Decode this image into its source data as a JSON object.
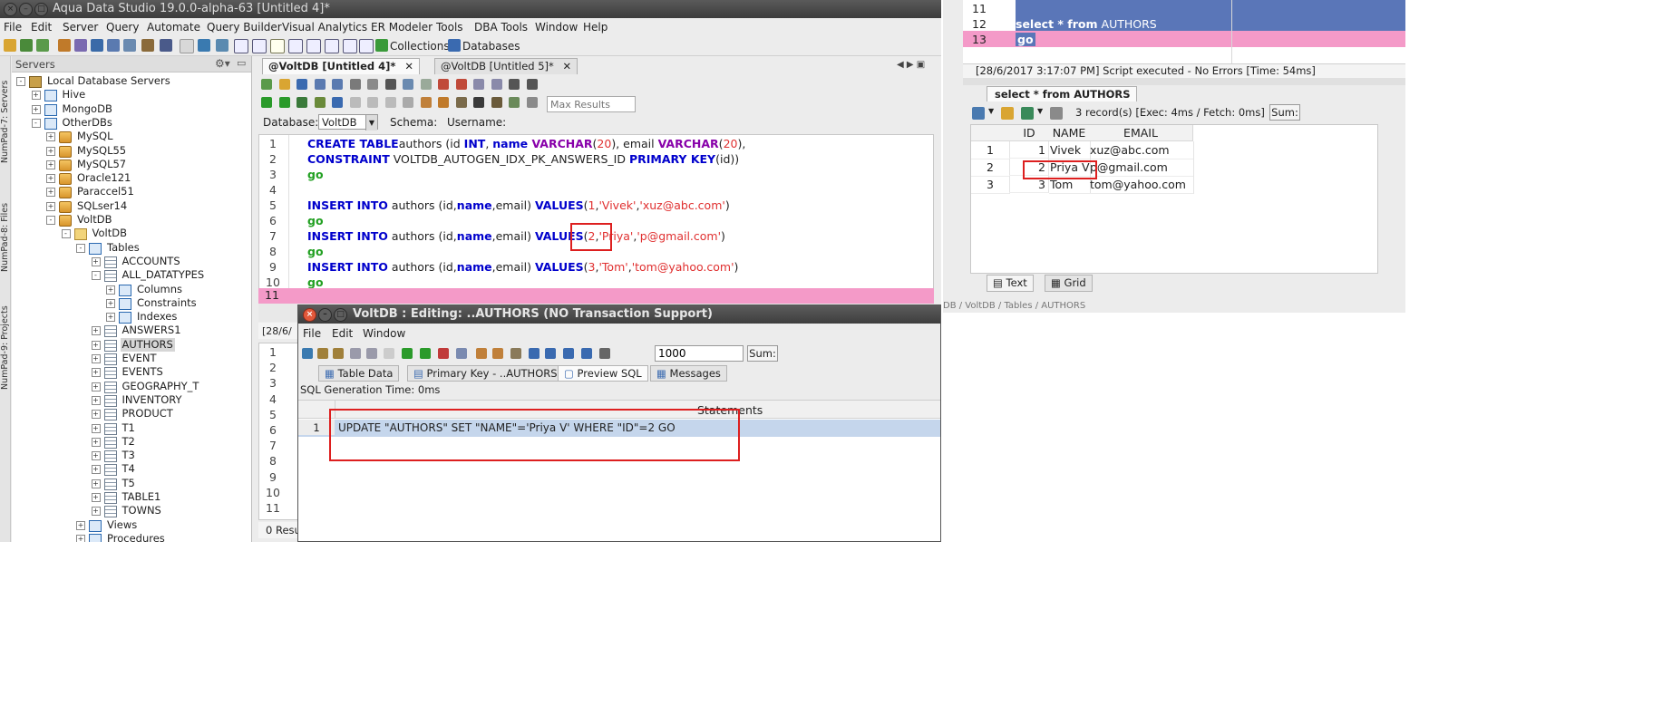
{
  "window": {
    "title": "Aqua Data Studio 19.0.0-alpha-63 [Untitled 4]*"
  },
  "menu": [
    "File",
    "Edit",
    "Server",
    "Query",
    "Automate",
    "Query Builder",
    "Visual Analytics",
    "ER Modeler",
    "Tools",
    "DBA Tools",
    "Window",
    "Help"
  ],
  "toolbar": {
    "collections": "Collections",
    "databases": "Databases"
  },
  "side_strip": [
    "NumPad-7: Servers",
    "NumPad-8: Files",
    "NumPad-9: Projects"
  ],
  "servers": {
    "header": "Servers",
    "tree": [
      {
        "label": "Local Database Servers",
        "depth": 0,
        "icon": "server-icon",
        "exp": "-"
      },
      {
        "label": "Hive",
        "depth": 1,
        "icon": "folder-icon",
        "exp": "+"
      },
      {
        "label": "MongoDB",
        "depth": 1,
        "icon": "folder-icon",
        "exp": "+"
      },
      {
        "label": "OtherDBs",
        "depth": 1,
        "icon": "folder-icon",
        "exp": "-"
      },
      {
        "label": "MySQL",
        "depth": 2,
        "icon": "database-icon",
        "exp": "+"
      },
      {
        "label": "MySQL55",
        "depth": 2,
        "icon": "database-icon",
        "exp": "+"
      },
      {
        "label": "MySQL57",
        "depth": 2,
        "icon": "database-icon",
        "exp": "+"
      },
      {
        "label": "Oracle121",
        "depth": 2,
        "icon": "database-icon",
        "exp": "+"
      },
      {
        "label": "Paraccel51",
        "depth": 2,
        "icon": "database-icon",
        "exp": "+"
      },
      {
        "label": "SQLser14",
        "depth": 2,
        "icon": "database-icon",
        "exp": "+"
      },
      {
        "label": "VoltDB",
        "depth": 2,
        "icon": "database-icon",
        "exp": "-"
      },
      {
        "label": "VoltDB",
        "depth": 3,
        "icon": "file-icon",
        "exp": "-"
      },
      {
        "label": "Tables",
        "depth": 4,
        "icon": "folder-icon",
        "exp": "-"
      },
      {
        "label": "ACCOUNTS",
        "depth": 5,
        "icon": "table-icon",
        "exp": "+"
      },
      {
        "label": "ALL_DATATYPES",
        "depth": 5,
        "icon": "table-icon",
        "exp": "-"
      },
      {
        "label": "Columns",
        "depth": 6,
        "icon": "folder-icon",
        "exp": "+"
      },
      {
        "label": "Constraints",
        "depth": 6,
        "icon": "folder-icon",
        "exp": "+"
      },
      {
        "label": "Indexes",
        "depth": 6,
        "icon": "folder-icon",
        "exp": "+"
      },
      {
        "label": "ANSWERS1",
        "depth": 5,
        "icon": "table-icon",
        "exp": "+"
      },
      {
        "label": "AUTHORS",
        "depth": 5,
        "icon": "table-icon",
        "exp": "+",
        "selected": true
      },
      {
        "label": "EVENT",
        "depth": 5,
        "icon": "table-icon",
        "exp": "+"
      },
      {
        "label": "EVENTS",
        "depth": 5,
        "icon": "table-icon",
        "exp": "+"
      },
      {
        "label": "GEOGRAPHY_T",
        "depth": 5,
        "icon": "table-icon",
        "exp": "+"
      },
      {
        "label": "INVENTORY",
        "depth": 5,
        "icon": "table-icon",
        "exp": "+"
      },
      {
        "label": "PRODUCT",
        "depth": 5,
        "icon": "table-icon",
        "exp": "+"
      },
      {
        "label": "T1",
        "depth": 5,
        "icon": "table-icon",
        "exp": "+"
      },
      {
        "label": "T2",
        "depth": 5,
        "icon": "table-icon",
        "exp": "+"
      },
      {
        "label": "T3",
        "depth": 5,
        "icon": "table-icon",
        "exp": "+"
      },
      {
        "label": "T4",
        "depth": 5,
        "icon": "table-icon",
        "exp": "+"
      },
      {
        "label": "T5",
        "depth": 5,
        "icon": "table-icon",
        "exp": "+"
      },
      {
        "label": "TABLE1",
        "depth": 5,
        "icon": "table-icon",
        "exp": "+"
      },
      {
        "label": "TOWNS",
        "depth": 5,
        "icon": "table-icon",
        "exp": "+"
      },
      {
        "label": "Views",
        "depth": 4,
        "icon": "folder-icon",
        "exp": "+"
      },
      {
        "label": "Procedures",
        "depth": 4,
        "icon": "folder-icon",
        "exp": "+"
      }
    ]
  },
  "editor": {
    "tabs": [
      "@VoltDB [Untitled 4]*",
      "@VoltDB [Untitled 5]*"
    ],
    "max_results_placeholder": "Max Results",
    "database_label": "Database:",
    "database_value": "VoltDB",
    "schema_label": "Schema:",
    "username_label": "Username:",
    "line_numbers": [
      "1",
      "2",
      "3",
      "4",
      "5",
      "6",
      "7",
      "8",
      "9",
      "10",
      "11"
    ],
    "code": {
      "l1": [
        [
          "kw",
          "CREATE TABLE"
        ],
        [
          "",
          "authors (id "
        ],
        [
          "kw",
          "INT"
        ],
        [
          "",
          ", "
        ],
        [
          "kw",
          "name"
        ],
        [
          "",
          ""
        ],
        [
          "ty",
          " VARCHAR"
        ],
        [
          "",
          "("
        ],
        [
          "num",
          "20"
        ],
        [
          "",
          "), email "
        ],
        [
          "ty",
          "VARCHAR"
        ],
        [
          "",
          "("
        ],
        [
          "num",
          "20"
        ],
        [
          "",
          "),"
        ]
      ],
      "l2": [
        [
          "kw",
          "CONSTRAINT"
        ],
        [
          "",
          " VOLTDB_AUTOGEN_IDX_PK_ANSWERS_ID "
        ],
        [
          "kw",
          "PRIMARY KEY"
        ],
        [
          "",
          "(id))"
        ]
      ],
      "l3": [
        [
          "go",
          "go"
        ]
      ],
      "l5": [
        [
          "kw",
          "INSERT INTO"
        ],
        [
          "",
          " authors (id,"
        ],
        [
          "kw",
          "name"
        ],
        [
          "",
          ",email) "
        ],
        [
          "kw",
          "VALUES"
        ],
        [
          "",
          "("
        ],
        [
          "num",
          "1"
        ],
        [
          "",
          ","
        ],
        [
          "str",
          "'Vivek'"
        ],
        [
          "",
          ","
        ],
        [
          "str",
          "'xuz@abc.com'"
        ],
        [
          "",
          ")"
        ]
      ],
      "l6": [
        [
          "go",
          "go"
        ]
      ],
      "l7": [
        [
          "kw",
          "INSERT INTO"
        ],
        [
          "",
          " authors (id,"
        ],
        [
          "kw",
          "name"
        ],
        [
          "",
          ",email) "
        ],
        [
          "kw",
          "VALUES"
        ],
        [
          "",
          "("
        ],
        [
          "num",
          "2"
        ],
        [
          "",
          ","
        ],
        [
          "str",
          "'Priya'"
        ],
        [
          "",
          ","
        ],
        [
          "str",
          "'p@gmail.com'"
        ],
        [
          "",
          ")"
        ]
      ],
      "l8": [
        [
          "go",
          "go"
        ]
      ],
      "l9": [
        [
          "kw",
          "INSERT INTO"
        ],
        [
          "",
          " authors (id,"
        ],
        [
          "kw",
          "name"
        ],
        [
          "",
          ",email) "
        ],
        [
          "kw",
          "VALUES"
        ],
        [
          "",
          "("
        ],
        [
          "num",
          "3"
        ],
        [
          "",
          ","
        ],
        [
          "str",
          "'Tom'"
        ],
        [
          "",
          ","
        ],
        [
          "str",
          "'tom@yahoo.com'"
        ],
        [
          "",
          ")"
        ]
      ],
      "l10": [
        [
          "go",
          "go"
        ]
      ]
    },
    "lower_prefix": "[28/6/",
    "lower_line_numbers": [
      "1",
      "2",
      "3",
      "4",
      "5",
      "6",
      "7",
      "8",
      "9",
      "10",
      "11"
    ],
    "lower_status": "0 Resu"
  },
  "dialog": {
    "title": "VoltDB : Editing: ..AUTHORS (NO Transaction Support)",
    "menu": [
      "File",
      "Edit",
      "Window"
    ],
    "max_rows": "1000",
    "sum_label": "Sum:",
    "tabs": [
      "Table Data",
      "Primary Key - ..AUTHORS",
      "Preview SQL",
      "Messages"
    ],
    "gen_time": "SQL Generation Time: 0ms",
    "col_header": "Statements",
    "row_num": "1",
    "statement": "UPDATE \"AUTHORS\" SET \"NAME\"='Priya V' WHERE \"ID\"=2 GO"
  },
  "right": {
    "line11": "11",
    "line12": "12",
    "line12_text": "select * from AUTHORS",
    "line13": "13",
    "line13_text": "go",
    "status": "[28/6/2017 3:17:07 PM] Script executed - No Errors [Time: 54ms]",
    "result_tab": "select * from AUTHORS",
    "records": "3 record(s) [Exec: 4ms / Fetch: 0ms]",
    "sum_label": "Sum:",
    "columns": [
      "ID",
      "NAME",
      "EMAIL"
    ],
    "rows": [
      {
        "n": "1",
        "id": "1",
        "name": "Vivek",
        "email": "xuz@abc.com"
      },
      {
        "n": "2",
        "id": "2",
        "name": "Priya V",
        "email": "p@gmail.com"
      },
      {
        "n": "3",
        "id": "3",
        "name": "Tom",
        "email": "tom@yahoo.com"
      }
    ],
    "bottom_tabs": [
      "Text",
      "Grid"
    ],
    "breadcrumb": "DB / VoltDB / Tables / AUTHORS"
  },
  "colors": {
    "highlight_pink": "#f49ac8",
    "select_blue": "#5a76b8",
    "annot_red": "#dd1f1f"
  }
}
